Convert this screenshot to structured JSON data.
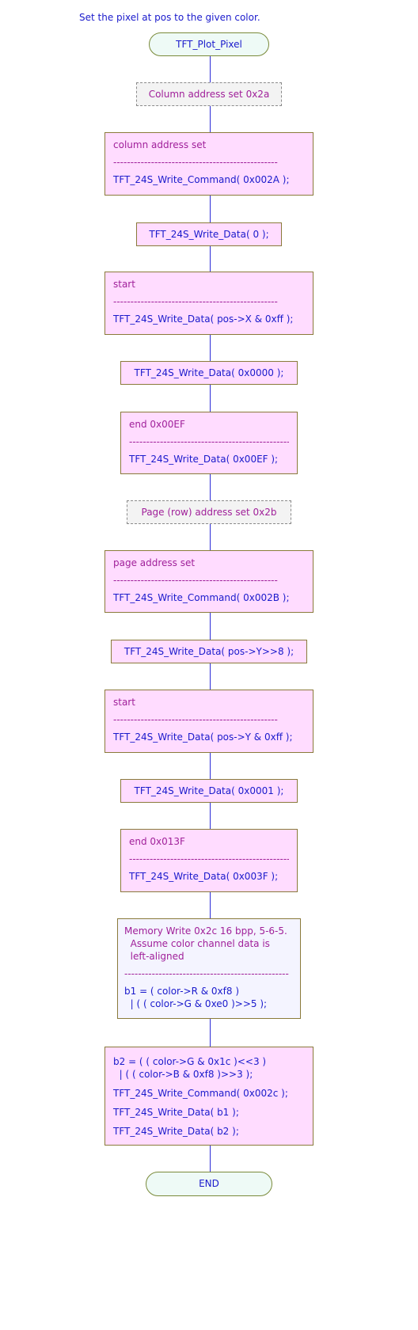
{
  "caption": "Set the pixel at pos to the given color.",
  "start_label": "TFT_Plot_Pixel",
  "end_label": "END",
  "separator": "------------------------------------------------",
  "steps": [
    {
      "kind": "comment",
      "text": "Column address set 0x2a"
    },
    {
      "kind": "block",
      "note": "column address set",
      "code": "TFT_24S_Write_Command( 0x002A );"
    },
    {
      "kind": "single",
      "code": "TFT_24S_Write_Data( 0 );"
    },
    {
      "kind": "block",
      "note": "start",
      "code": "TFT_24S_Write_Data( pos->X & 0xff );"
    },
    {
      "kind": "single",
      "code": "TFT_24S_Write_Data( 0x0000 );"
    },
    {
      "kind": "block",
      "note": "end 0x00EF",
      "code": "TFT_24S_Write_Data( 0x00EF );"
    },
    {
      "kind": "comment",
      "text": "Page (row) address set 0x2b"
    },
    {
      "kind": "block",
      "note": "page address set",
      "code": "TFT_24S_Write_Command( 0x002B );"
    },
    {
      "kind": "single",
      "code": "TFT_24S_Write_Data( pos->Y>>8 );"
    },
    {
      "kind": "block",
      "note": "start",
      "code": "TFT_24S_Write_Data( pos->Y & 0xff );"
    },
    {
      "kind": "single",
      "code": "TFT_24S_Write_Data( 0x0001 );"
    },
    {
      "kind": "block",
      "note": "end 0x013F",
      "code": "TFT_24S_Write_Data( 0x003F );"
    },
    {
      "kind": "memory",
      "note": "Memory Write 0x2c 16 bpp, 5-6-5.\n  Assume color channel data is\n  left-aligned",
      "code": "b1 = ( color->R & 0xf8 )\n  | ( ( color->G & 0xe0 )>>5 );"
    },
    {
      "kind": "final",
      "code_lines": [
        "b2 = ( ( color->G & 0x1c )<<3 )\n  | ( ( color->B & 0xf8 )>>3 );",
        "TFT_24S_Write_Command( 0x002c );",
        "TFT_24S_Write_Data( b1 );",
        "TFT_24S_Write_Data( b2 );"
      ]
    }
  ]
}
